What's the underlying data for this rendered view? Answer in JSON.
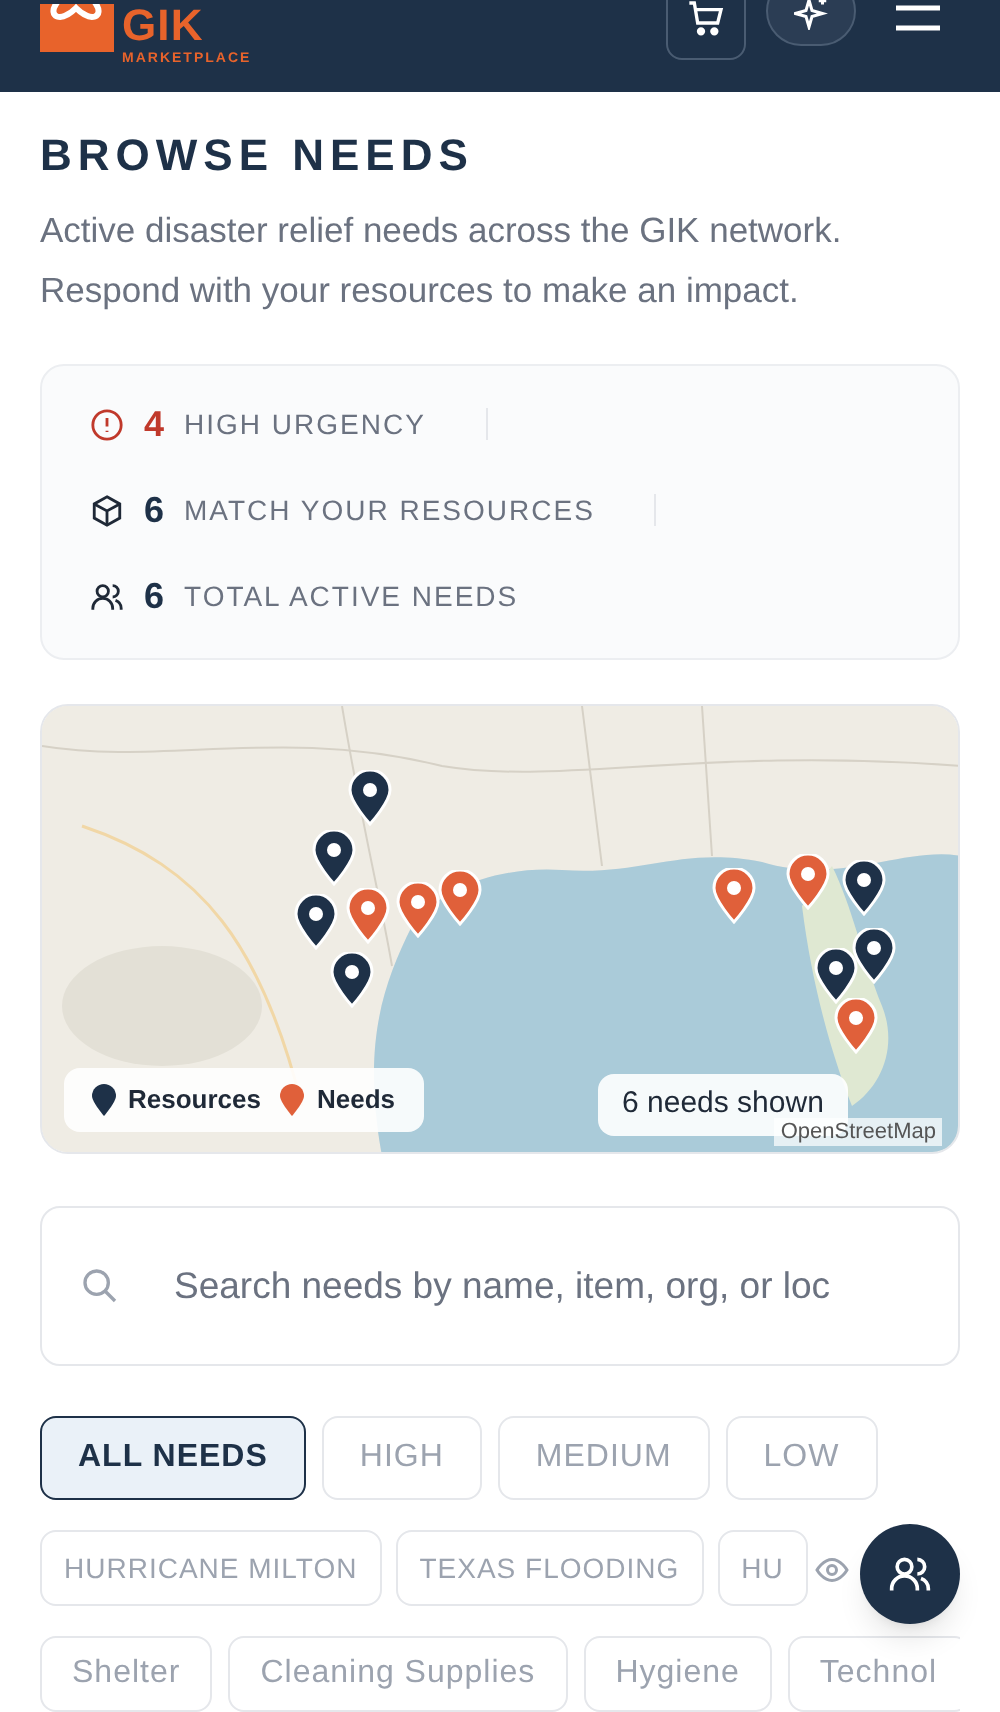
{
  "header": {
    "logo_text": "GIK",
    "logo_subtitle": "MARKETPLACE"
  },
  "title": "BROWSE NEEDS",
  "subtitle": "Active disaster relief needs across the GIK network. Respond with your resources to make an impact.",
  "stats": [
    {
      "kind": "urgent",
      "count": "4",
      "label": "HIGH URGENCY"
    },
    {
      "kind": "match",
      "count": "6",
      "label": "MATCH YOUR RESOURCES"
    },
    {
      "kind": "total",
      "count": "6",
      "label": "TOTAL ACTIVE NEEDS"
    }
  ],
  "map": {
    "pins": [
      {
        "kind": "resource"
      },
      {
        "kind": "resource"
      },
      {
        "kind": "resource"
      },
      {
        "kind": "resource"
      },
      {
        "kind": "resource"
      },
      {
        "kind": "resource"
      },
      {
        "kind": "resource"
      },
      {
        "kind": "need"
      },
      {
        "kind": "need"
      },
      {
        "kind": "need"
      },
      {
        "kind": "need"
      },
      {
        "kind": "need"
      },
      {
        "kind": "need"
      }
    ],
    "legend": [
      {
        "kind": "resource",
        "label": "Resources"
      },
      {
        "kind": "need",
        "label": "Needs"
      }
    ],
    "count_label": "6 needs shown",
    "attribution": "OpenStreetMap"
  },
  "search": {
    "placeholder": "Search needs by name, item, org, or loc"
  },
  "urgency_filters": [
    {
      "label": "ALL NEEDS",
      "selected": true
    },
    {
      "label": "HIGH",
      "selected": false
    },
    {
      "label": "MEDIUM",
      "selected": false
    },
    {
      "label": "LOW",
      "selected": false
    }
  ],
  "event_filters": [
    {
      "label": "HURRICANE MILTON",
      "selected": false
    },
    {
      "label": "TEXAS FLOODING",
      "selected": false
    },
    {
      "label": "HU",
      "selected": false
    }
  ],
  "category_filters": [
    {
      "label": "Shelter",
      "selected": false
    },
    {
      "label": "Cleaning Supplies",
      "selected": false
    },
    {
      "label": "Hygiene",
      "selected": false
    },
    {
      "label": "Technol",
      "selected": false
    }
  ]
}
